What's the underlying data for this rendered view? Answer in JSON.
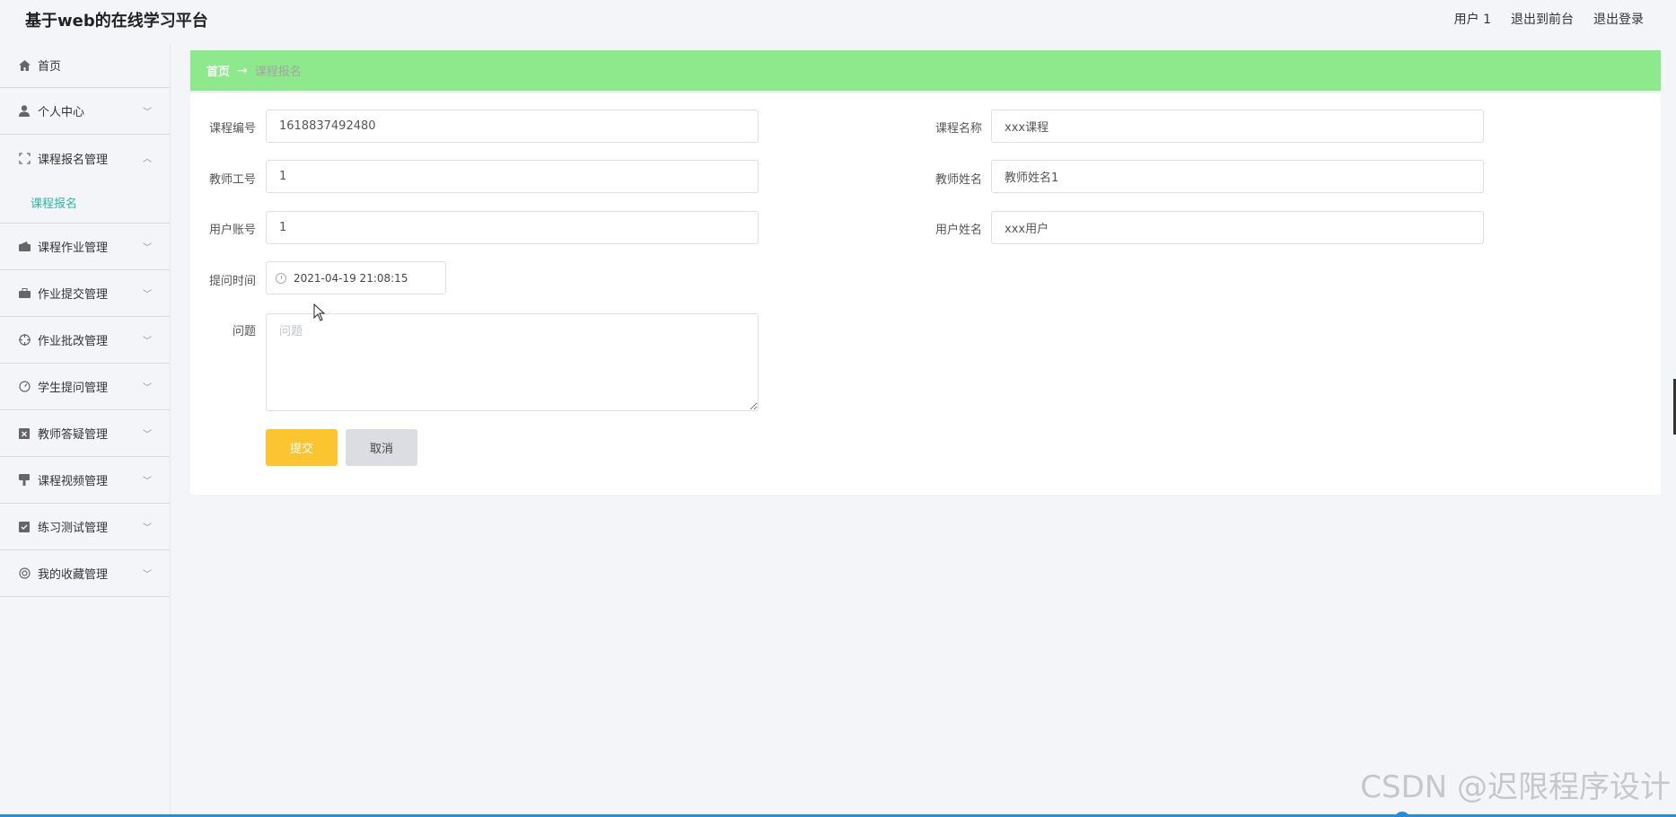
{
  "header": {
    "title": "基于web的在线学习平台",
    "links": [
      "用户 1",
      "退出到前台",
      "退出登录"
    ]
  },
  "sidebar": {
    "items": [
      {
        "label": "首页",
        "icon": "home-icon"
      },
      {
        "label": "个人中心",
        "icon": "user-icon"
      },
      {
        "label": "课程报名管理",
        "icon": "expand-icon"
      },
      {
        "label": "课程作业管理",
        "icon": "wallet-icon"
      },
      {
        "label": "作业提交管理",
        "icon": "briefcase-icon"
      },
      {
        "label": "作业批改管理",
        "icon": "target-icon"
      },
      {
        "label": "学生提问管理",
        "icon": "gauge-icon"
      },
      {
        "label": "教师答疑管理",
        "icon": "clipboard-x-icon"
      },
      {
        "label": "课程视频管理",
        "icon": "brush-icon"
      },
      {
        "label": "练习测试管理",
        "icon": "clipboard-check-icon"
      },
      {
        "label": "我的收藏管理",
        "icon": "lifebuoy-icon"
      }
    ],
    "submenu_label": "课程报名"
  },
  "breadcrumb": {
    "home": "首页",
    "arrow": "→",
    "current": "课程报名"
  },
  "form": {
    "course_no_label": "课程编号",
    "course_no_value": "1618837492480",
    "course_name_label": "课程名称",
    "course_name_value": "xxx课程",
    "teacher_no_label": "教师工号",
    "teacher_no_value": "1",
    "teacher_name_label": "教师姓名",
    "teacher_name_value": "教师姓名1",
    "user_account_label": "用户账号",
    "user_account_value": "1",
    "user_name_label": "用户姓名",
    "user_name_value": "xxx用户",
    "ask_time_label": "提问时间",
    "ask_time_value": "2021-04-19 21:08:15",
    "question_label": "问题",
    "question_placeholder": "问题",
    "submit_label": "提交",
    "cancel_label": "取消"
  },
  "watermark": "CSDN @迟限程序设计",
  "colors": {
    "breadcrumb_bg": "#8de98b",
    "submit_bg": "#fbc531",
    "submenu_active": "#2fb7a4"
  }
}
